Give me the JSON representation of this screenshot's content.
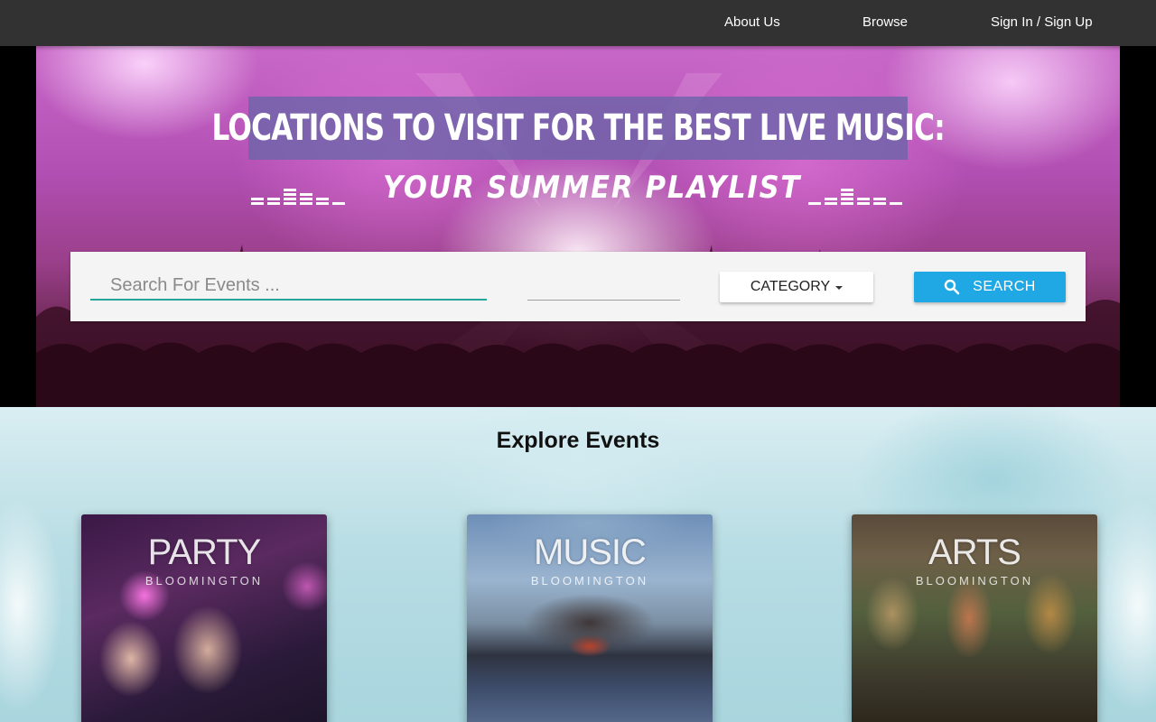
{
  "nav": {
    "about_label": "About Us",
    "browse_label": "Browse",
    "signin_label": "Sign In / Sign Up"
  },
  "hero": {
    "headline": "Locations to visit for the best live music:",
    "subhead": "Your Summer Playlist"
  },
  "search": {
    "placeholder": "Search For Events ...",
    "date_value": "",
    "category_label": "Category",
    "search_label": "Search",
    "search_icon": "search-icon",
    "accent_color": "#26a69a",
    "button_color": "#1fa8e4"
  },
  "explore": {
    "title": "Explore Events",
    "cards": [
      {
        "title": "Party",
        "subtitle": "Bloomington"
      },
      {
        "title": "Music",
        "subtitle": "Bloomington"
      },
      {
        "title": "Arts",
        "subtitle": "Bloomington"
      }
    ]
  },
  "colors": {
    "navbar": "#323232"
  }
}
